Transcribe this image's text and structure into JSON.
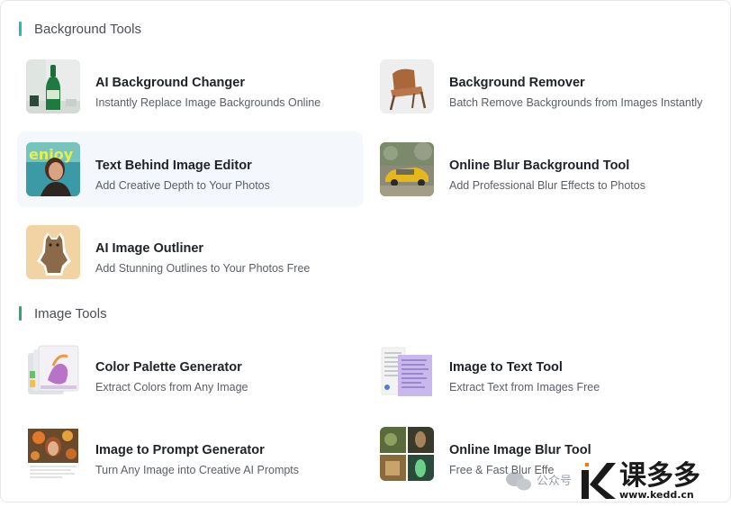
{
  "sections": [
    {
      "title": "Background Tools",
      "accent": "#2bb3c0",
      "items": [
        {
          "title": "AI Background Changer",
          "desc": "Instantly Replace Image Backgrounds Online",
          "icon": "bottle-photo"
        },
        {
          "title": "Background Remover",
          "desc": "Batch Remove Backgrounds from Images Instantly",
          "icon": "chair-photo"
        },
        {
          "title": "Text Behind Image Editor",
          "desc": "Add Creative Depth to Your Photos",
          "icon": "portrait-text-photo"
        },
        {
          "title": "Online Blur Background Tool",
          "desc": "Add Professional Blur Effects to Photos",
          "icon": "car-photo"
        },
        {
          "title": "AI Image Outliner",
          "desc": "Add Stunning Outlines to Your Photos Free",
          "icon": "cat-sticker"
        }
      ]
    },
    {
      "title": "Image Tools",
      "accent": "#2aa86a",
      "items": [
        {
          "title": "Color Palette Generator",
          "desc": "Extract Colors from Any Image",
          "icon": "palette-cards"
        },
        {
          "title": "Image to Text Tool",
          "desc": "Extract Text from Images Free",
          "icon": "document-scan"
        },
        {
          "title": "Image to Prompt Generator",
          "desc": "Turn Any Image into Creative AI Prompts",
          "icon": "flowers-photo"
        },
        {
          "title": "Online Image Blur Tool",
          "desc": "Free & Fast Blur Effe",
          "icon": "blur-grid"
        }
      ]
    }
  ],
  "watermark": {
    "brand_cn": "课多多",
    "brand_url": "www.kedd.cn",
    "wechat_text": "公众号"
  }
}
